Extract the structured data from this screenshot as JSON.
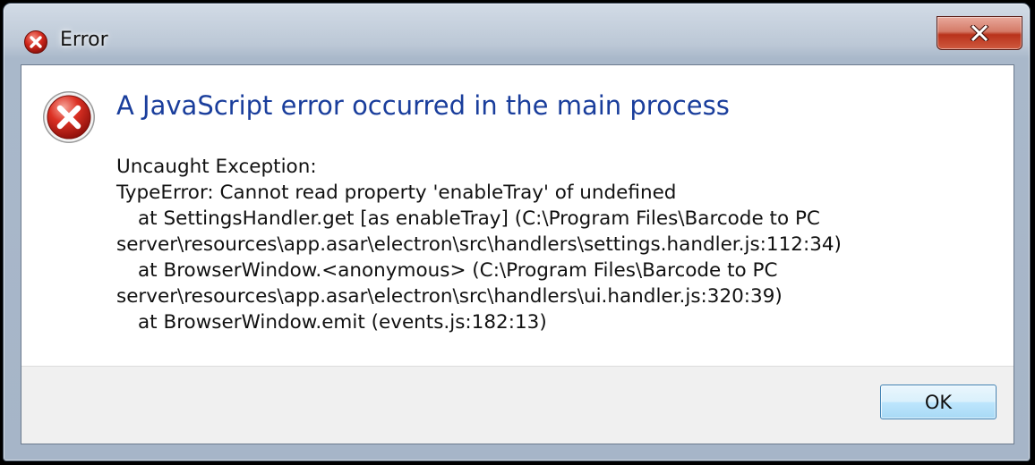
{
  "window": {
    "title": "Error",
    "title_icon": "error-icon",
    "close_label": "close"
  },
  "dialog": {
    "icon": "error-icon",
    "heading": "A JavaScript error occurred in the main process",
    "message_lines": [
      "Uncaught Exception:",
      "TypeError: Cannot read property 'enableTray' of undefined",
      "at SettingsHandler.get [as enableTray] (C:\\Program Files\\Barcode to PC",
      "server\\resources\\app.asar\\electron\\src\\handlers\\settings.handler.js:112:34)",
      "at BrowserWindow.<anonymous> (C:\\Program Files\\Barcode to PC",
      "server\\resources\\app.asar\\electron\\src\\handlers\\ui.handler.js:320:39)",
      "at BrowserWindow.emit (events.js:182:13)"
    ],
    "ok_label": "OK"
  },
  "colors": {
    "heading": "#1a3e9c",
    "error_red": "#c8261c",
    "close_button": "#c9432b"
  }
}
